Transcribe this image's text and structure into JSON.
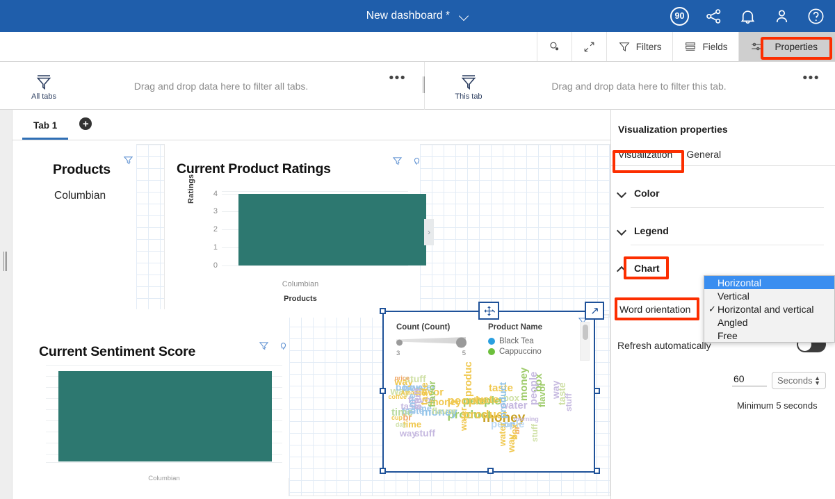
{
  "topbar": {
    "title": "New dashboard *",
    "dropdown_icon": "chevron-down-icon",
    "badge": "90",
    "icons": [
      "share-icon",
      "bell-icon",
      "user-icon",
      "help-icon"
    ]
  },
  "toolbar": {
    "items": [
      {
        "label": "",
        "icon": "search-data-icon"
      },
      {
        "label": "",
        "icon": "expand-icon"
      },
      {
        "label": "Filters",
        "icon": "funnel-icon"
      },
      {
        "label": "Fields",
        "icon": "fields-icon"
      },
      {
        "label": "Properties",
        "icon": "properties-icon"
      }
    ]
  },
  "filter_bands": [
    {
      "icon_label": "All tabs",
      "hint": "Drag and drop data here to filter all tabs.",
      "menu": "•••"
    },
    {
      "icon_label": "This tab",
      "hint": "Drag and drop data here to filter this tab.",
      "menu": "•••"
    }
  ],
  "tabs": {
    "items": [
      {
        "label": "Tab 1"
      }
    ],
    "add_label": "+"
  },
  "widgets": {
    "products": {
      "title": "Products",
      "value": "Columbian",
      "icons": [
        "funnel-icon",
        "insight-icon"
      ]
    },
    "ratings": {
      "title": "Current Product Ratings",
      "icons": [
        "funnel-icon",
        "insight-icon"
      ],
      "scroll_arrow": "›"
    },
    "sentiment": {
      "title": "Current Sentiment Score",
      "icons": [
        "funnel-icon",
        "insight-icon"
      ],
      "category": "Columbian"
    },
    "wordcloud": {
      "legend_count_title": "Count (Count)",
      "legend_count_min": "3",
      "legend_count_max": "5",
      "legend_product_title": "Product Name",
      "legend_items": [
        {
          "label": "Black Tea",
          "color": "#2a9fe0"
        },
        {
          "label": "Cappuccino",
          "color": "#6cbf3c"
        }
      ],
      "icons": [
        "funnel-icon",
        "move-icon",
        "expand-widget-icon"
      ]
    }
  },
  "chart_data": [
    {
      "type": "bar",
      "title": "Current Product Ratings",
      "categories": [
        "Columbian"
      ],
      "values": [
        4.2
      ],
      "xlabel": "Products",
      "ylabel": "Ratings",
      "ytick_labels": [
        "4",
        "3",
        "2",
        "1",
        "0"
      ],
      "ylim": [
        0,
        4.4
      ],
      "grid": true,
      "legend": "none",
      "bar_color": "#2d7870"
    },
    {
      "type": "bar",
      "title": "Current Sentiment Score",
      "categories": [
        "Columbian"
      ],
      "values": [
        1.0
      ],
      "xlabel": "",
      "ylabel": "",
      "ytick_labels": [],
      "ylim": [
        0,
        1.05
      ],
      "grid": true,
      "legend": "none",
      "bar_color": "#2d7870"
    },
    {
      "type": "wordcloud",
      "title": "",
      "legend": "right",
      "size_scale_label": "Count (Count)",
      "size_scale_range": [
        3,
        5
      ],
      "color_legend_label": "Product Name",
      "color_legend": [
        {
          "label": "Black Tea",
          "color": "#2a9fe0"
        },
        {
          "label": "Cappuccino",
          "color": "#6cbf3c"
        }
      ],
      "words": [
        {
          "text": "money",
          "weight": 5,
          "color": "#c9a227",
          "size": 19
        },
        {
          "text": "people",
          "weight": 5,
          "color": "#9ecb6a",
          "size": 17
        },
        {
          "text": "product",
          "weight": 5,
          "color": "#9ecb6a",
          "size": 17
        },
        {
          "text": "people",
          "weight": 5,
          "color": "#f0c84f",
          "size": 17
        },
        {
          "text": "product",
          "weight": 5,
          "color": "#f0c84f",
          "size": 17
        },
        {
          "text": "money",
          "weight": 4,
          "color": "#8fc3e8",
          "size": 16
        },
        {
          "text": "water",
          "weight": 4,
          "color": "#f0c84f",
          "size": 16
        },
        {
          "text": "taste",
          "weight": 4,
          "color": "#f0c84f",
          "size": 15
        },
        {
          "text": "flavor",
          "weight": 4,
          "color": "#f0c84f",
          "size": 15
        },
        {
          "text": "people",
          "weight": 4,
          "color": "#bdd9f2",
          "size": 15
        },
        {
          "text": "box",
          "weight": 4,
          "color": "#9dc6ea",
          "size": 15
        },
        {
          "text": "water",
          "weight": 4,
          "color": "#c6b9e0",
          "size": 15
        },
        {
          "text": "taste",
          "weight": 4,
          "color": "#9dc6ea",
          "size": 14
        },
        {
          "text": "time",
          "weight": 4,
          "color": "#b9dba0",
          "size": 15
        },
        {
          "text": "way",
          "weight": 4,
          "color": "#cfe0a6",
          "size": 15
        },
        {
          "text": "box",
          "weight": 4,
          "color": "#9dc6ea",
          "size": 14
        },
        {
          "text": "way",
          "weight": 4,
          "color": "#f0c84f",
          "size": 14
        },
        {
          "text": "stuff",
          "weight": 4,
          "color": "#c6b9e0",
          "size": 14
        },
        {
          "text": "stuff",
          "weight": 4,
          "color": "#cfe0a6",
          "size": 14
        },
        {
          "text": "flavor",
          "weight": 4,
          "color": "#c6b9e0",
          "size": 14
        },
        {
          "text": "water",
          "weight": 4,
          "color": "#9dc6ea",
          "size": 14
        },
        {
          "text": "money",
          "weight": 4,
          "color": "#f0c84f",
          "size": 14
        },
        {
          "text": "br",
          "weight": 3,
          "color": "#f0a868",
          "size": 13
        },
        {
          "text": "time",
          "weight": 3,
          "color": "#f0c84f",
          "size": 13
        },
        {
          "text": "time",
          "weight": 3,
          "color": "#9dc6ea",
          "size": 13
        },
        {
          "text": "flavor",
          "weight": 3,
          "color": "#cfe0a6",
          "size": 13
        },
        {
          "text": "box",
          "weight": 3,
          "color": "#cfe0a6",
          "size": 13
        },
        {
          "text": "taste",
          "weight": 3,
          "color": "#c6b9e0",
          "size": 13
        },
        {
          "text": "way",
          "weight": 3,
          "color": "#c6b9e0",
          "size": 13
        },
        {
          "text": "coffee",
          "weight": 2,
          "color": "#f0c84f",
          "size": 9
        },
        {
          "text": "cup",
          "weight": 2,
          "color": "#f0c84f",
          "size": 9
        },
        {
          "text": "Amazon",
          "weight": 2,
          "color": "#f0c84f",
          "size": 9
        },
        {
          "text": "price",
          "weight": 2,
          "color": "#f0a868",
          "size": 9
        },
        {
          "text": "day",
          "weight": 2,
          "color": "#cfe0a6",
          "size": 9
        },
        {
          "text": "morning",
          "weight": 2,
          "color": "#c6b9e0",
          "size": 9
        },
        {
          "text": "stuff",
          "weight": 2,
          "color": "#9dc6ea",
          "size": 9
        }
      ]
    }
  ],
  "properties_panel": {
    "title": "Visualization properties",
    "tabs": [
      {
        "label": "Visualization",
        "active": true
      },
      {
        "label": "General",
        "active": false
      }
    ],
    "sections": [
      {
        "label": "Color",
        "expanded": false
      },
      {
        "label": "Legend",
        "expanded": false
      },
      {
        "label": "Chart",
        "expanded": true
      }
    ],
    "word_orientation_label": "Word orientation",
    "word_orientation_options": [
      {
        "label": "Horizontal",
        "selected": true,
        "checked": false
      },
      {
        "label": "Vertical",
        "selected": false,
        "checked": false
      },
      {
        "label": "Horizontal and vertical",
        "selected": false,
        "checked": true
      },
      {
        "label": "Angled",
        "selected": false,
        "checked": false
      },
      {
        "label": "Free",
        "selected": false,
        "checked": false
      }
    ],
    "refresh_label": "Refresh automatically",
    "refresh_value": "60",
    "refresh_unit": "Seconds",
    "refresh_note": "Minimum 5 seconds"
  },
  "highlights": {
    "properties_button": "Properties",
    "visualization_tab": "Visualization",
    "chart_section": "Chart",
    "word_orientation": "Word orientation",
    "color": "#fc2e00"
  }
}
